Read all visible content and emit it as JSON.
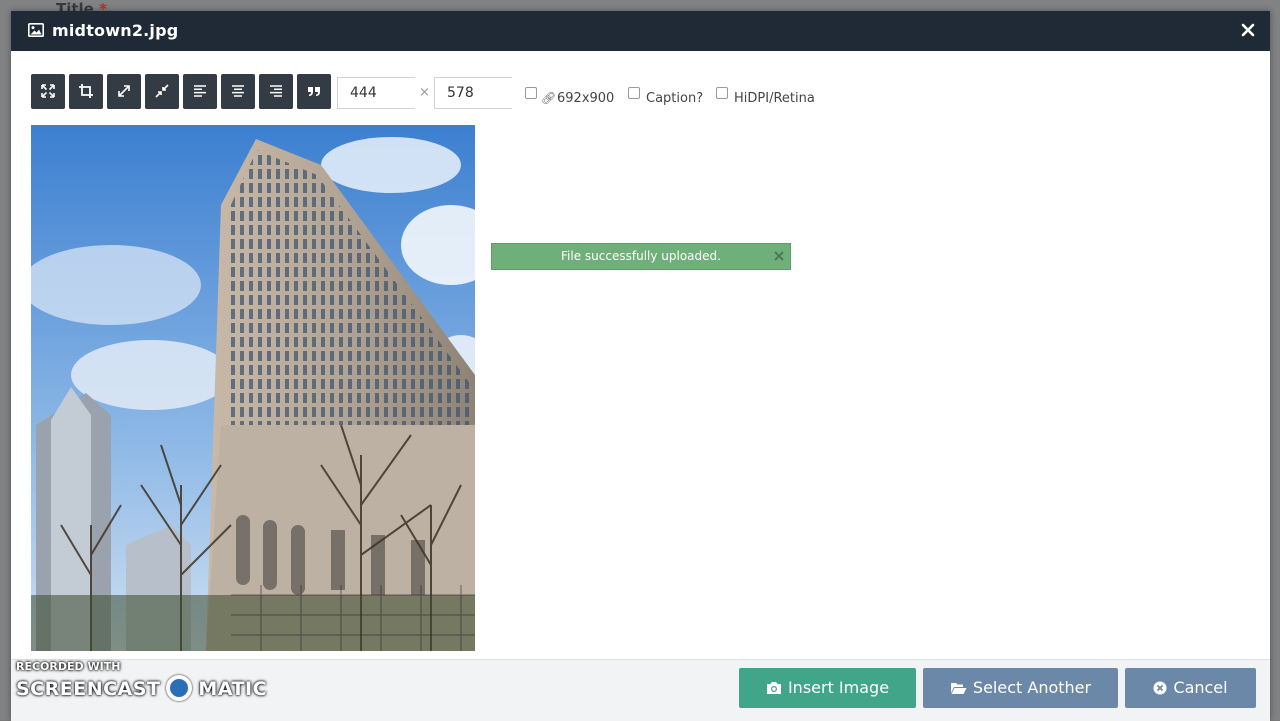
{
  "background": {
    "title": "Title",
    "required_mark": "*"
  },
  "modal": {
    "title": "midtown2.jpg",
    "title_icon": "image-icon",
    "close_icon": "close-icon"
  },
  "toolbar": {
    "buttons": [
      {
        "name": "expand-icon"
      },
      {
        "name": "crop-icon"
      },
      {
        "name": "resize-expand-icon"
      },
      {
        "name": "resize-compress-icon"
      },
      {
        "name": "align-left-icon"
      },
      {
        "name": "align-center-icon"
      },
      {
        "name": "align-right-icon"
      },
      {
        "name": "quote-icon"
      }
    ],
    "width_value": "444",
    "height_value": "578",
    "dimension_separator": "×",
    "original_size_label": "692x900",
    "caption_label": "Caption?",
    "hidpi_label": "HiDPI/Retina"
  },
  "alert": {
    "message": "File successfully uploaded."
  },
  "footer": {
    "insert_label": "Insert Image",
    "select_another_label": "Select Another",
    "cancel_label": "Cancel"
  },
  "colors": {
    "header": "#1f2a36",
    "insert": "#41a58a",
    "select_another": "#6c88a8",
    "cancel": "#6c88a8",
    "alert": "#6fb07a"
  },
  "watermark": {
    "line1": "RECORDED WITH",
    "line2_left": "SCREENCAST",
    "line2_right": "MATIC"
  }
}
